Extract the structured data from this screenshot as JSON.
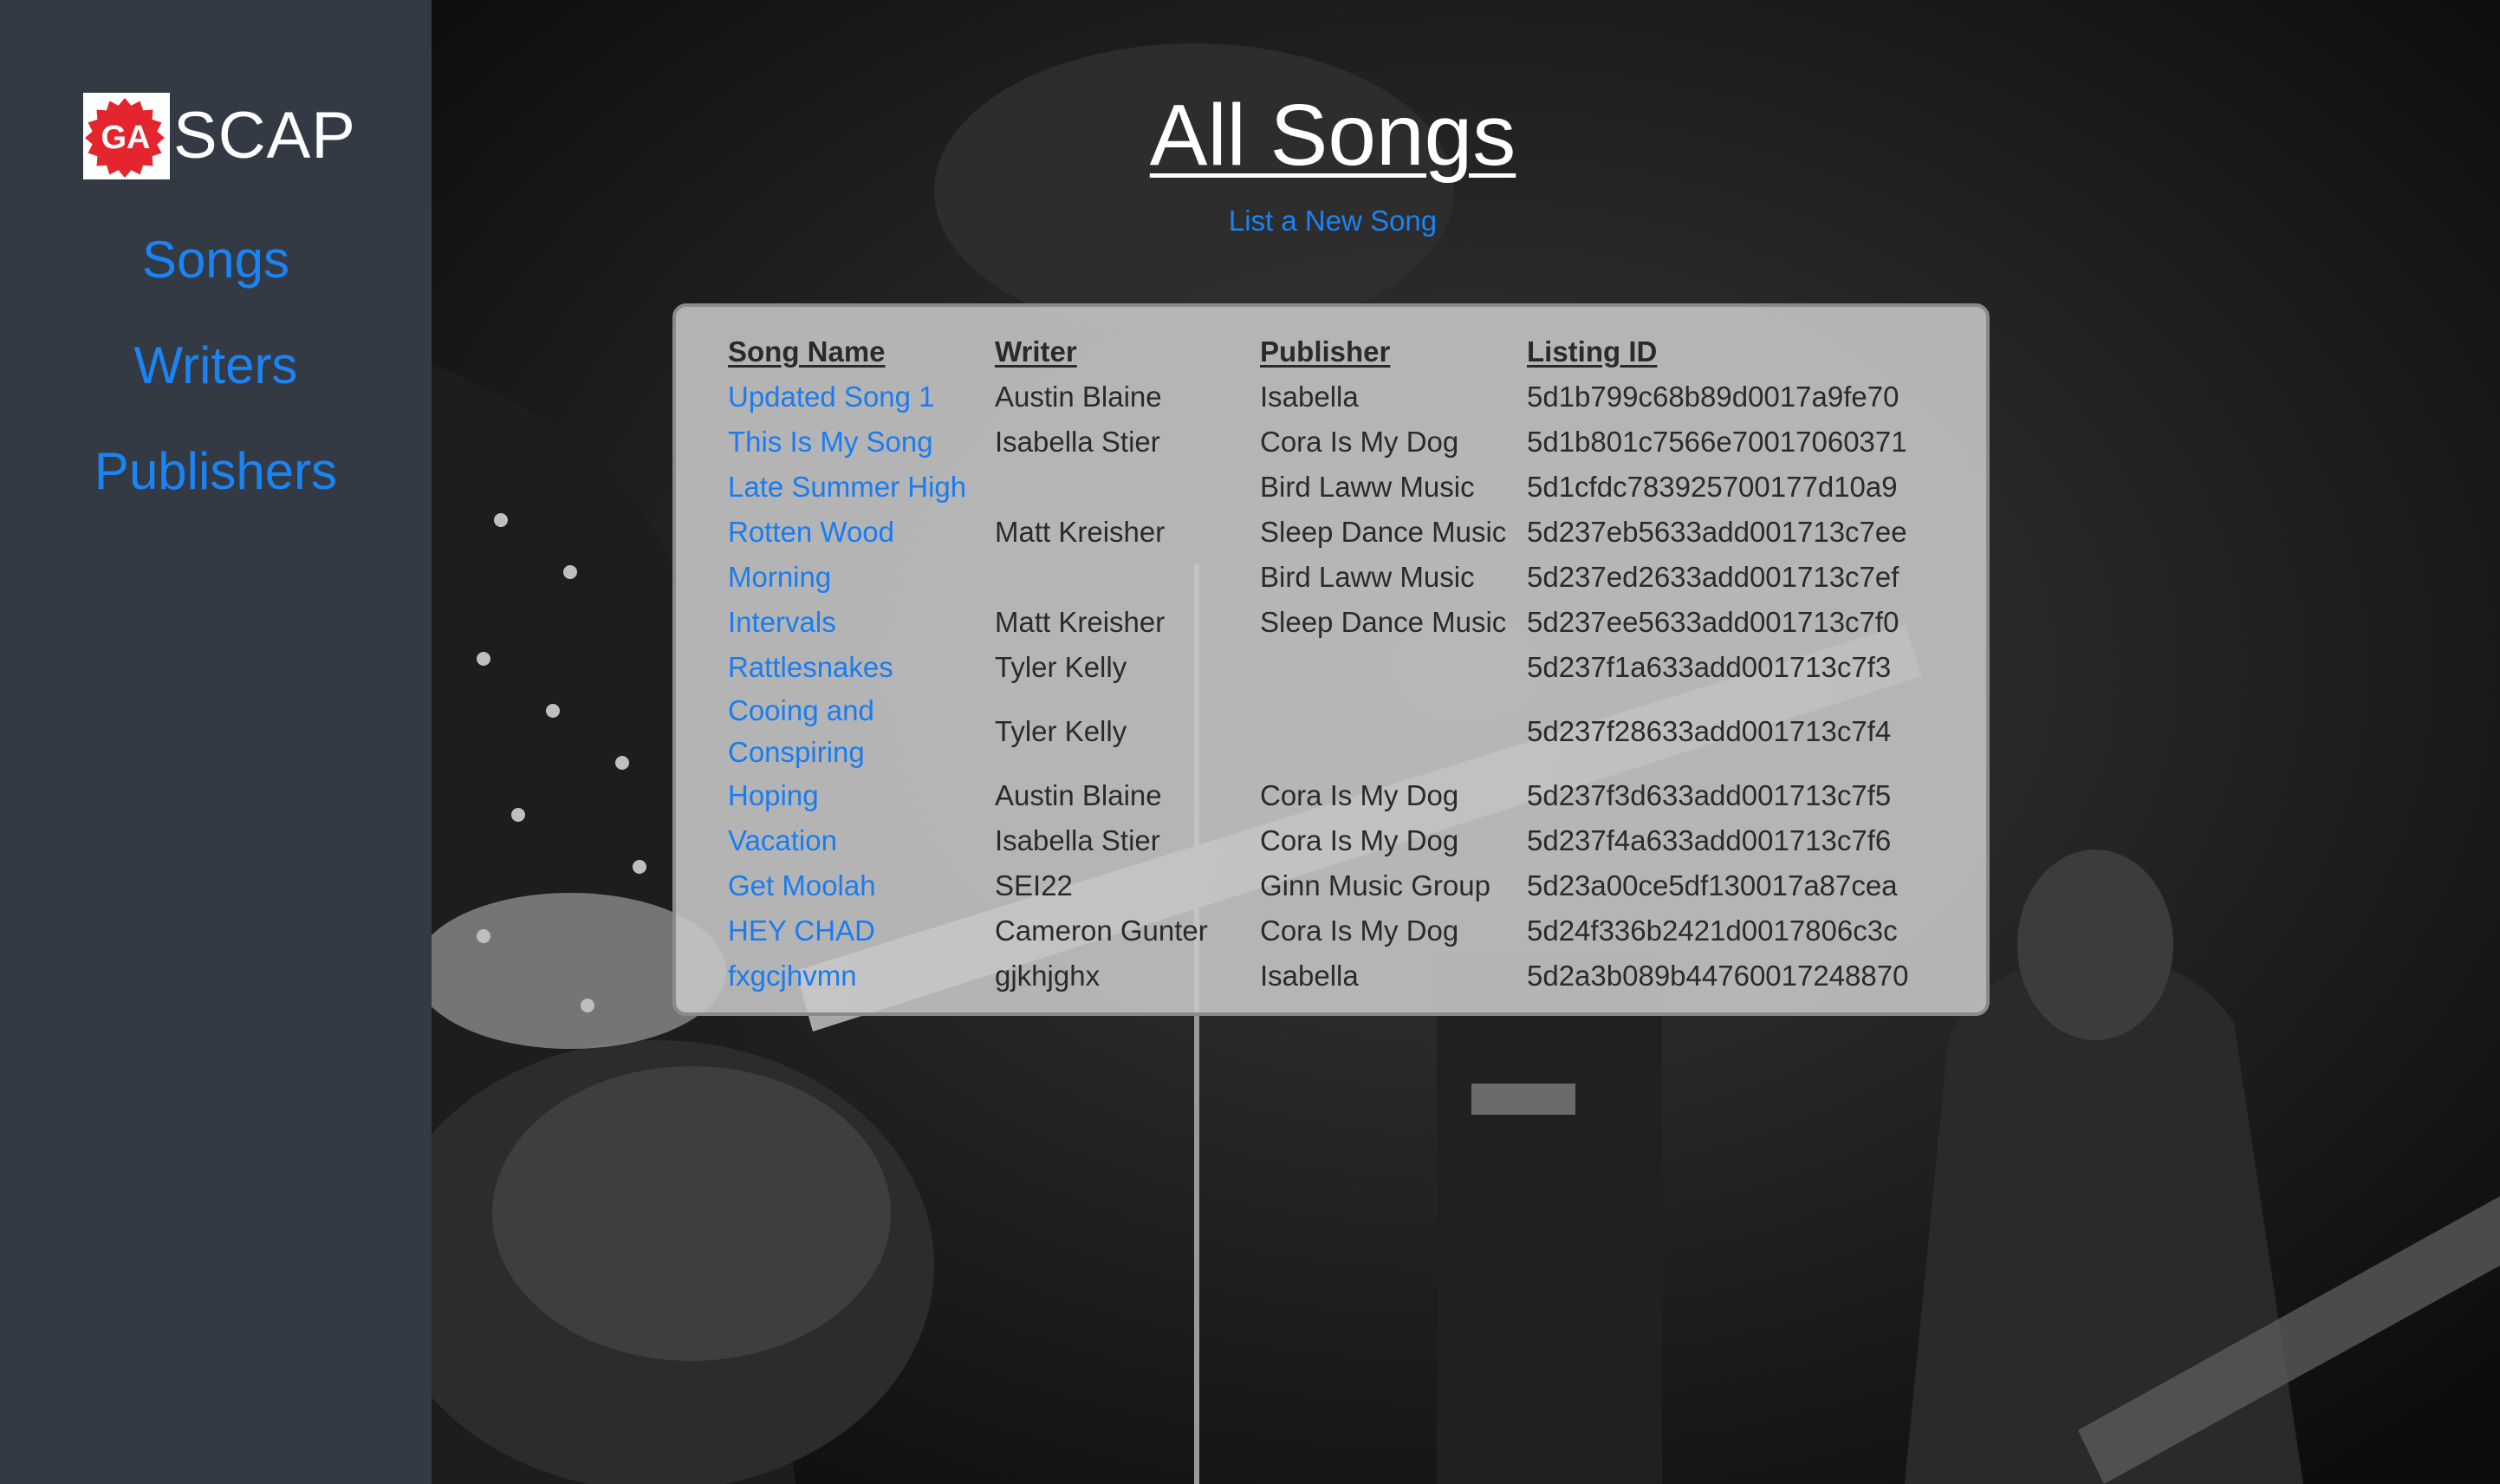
{
  "brand": {
    "logo_text": "GA",
    "name": "SCAP"
  },
  "nav": {
    "songs": "Songs",
    "writers": "Writers",
    "publishers": "Publishers"
  },
  "header": {
    "title": "All Songs",
    "new_song_link": "List a New Song"
  },
  "table": {
    "columns": [
      "Song Name",
      "Writer",
      "Publisher",
      "Listing ID"
    ],
    "rows": [
      {
        "song": "Updated Song 1",
        "writer": "Austin Blaine",
        "publisher": "Isabella",
        "id": "5d1b799c68b89d0017a9fe70"
      },
      {
        "song": "This Is My Song",
        "writer": "Isabella Stier",
        "publisher": "Cora Is My Dog",
        "id": "5d1b801c7566e70017060371"
      },
      {
        "song": "Late Summer High",
        "writer": "",
        "publisher": "Bird Laww Music",
        "id": "5d1cfdc783925700177d10a9"
      },
      {
        "song": "Rotten Wood",
        "writer": "Matt Kreisher",
        "publisher": "Sleep Dance Music",
        "id": "5d237eb5633add001713c7ee"
      },
      {
        "song": "Morning",
        "writer": "",
        "publisher": "Bird Laww Music",
        "id": "5d237ed2633add001713c7ef"
      },
      {
        "song": "Intervals",
        "writer": "Matt Kreisher",
        "publisher": "Sleep Dance Music",
        "id": "5d237ee5633add001713c7f0"
      },
      {
        "song": "Rattlesnakes",
        "writer": "Tyler Kelly",
        "publisher": "",
        "id": "5d237f1a633add001713c7f3"
      },
      {
        "song": "Cooing and Conspiring",
        "writer": "Tyler Kelly",
        "publisher": "",
        "id": "5d237f28633add001713c7f4"
      },
      {
        "song": "Hoping",
        "writer": "Austin Blaine",
        "publisher": "Cora Is My Dog",
        "id": "5d237f3d633add001713c7f5"
      },
      {
        "song": "Vacation",
        "writer": "Isabella Stier",
        "publisher": "Cora Is My Dog",
        "id": "5d237f4a633add001713c7f6"
      },
      {
        "song": "Get Moolah",
        "writer": "SEI22",
        "publisher": "Ginn Music Group",
        "id": "5d23a00ce5df130017a87cea"
      },
      {
        "song": "HEY CHAD",
        "writer": "Cameron Gunter",
        "publisher": "Cora Is My Dog",
        "id": "5d24f336b2421d0017806c3c"
      },
      {
        "song": "fxgcjhvmn",
        "writer": "gjkhjghx",
        "publisher": "Isabella",
        "id": "5d2a3b089b44760017248870"
      }
    ]
  },
  "colors": {
    "sidebar": "#343a43",
    "link": "#1a84f5",
    "panel": "#c8c8c8",
    "logo_red": "#e4252d"
  }
}
